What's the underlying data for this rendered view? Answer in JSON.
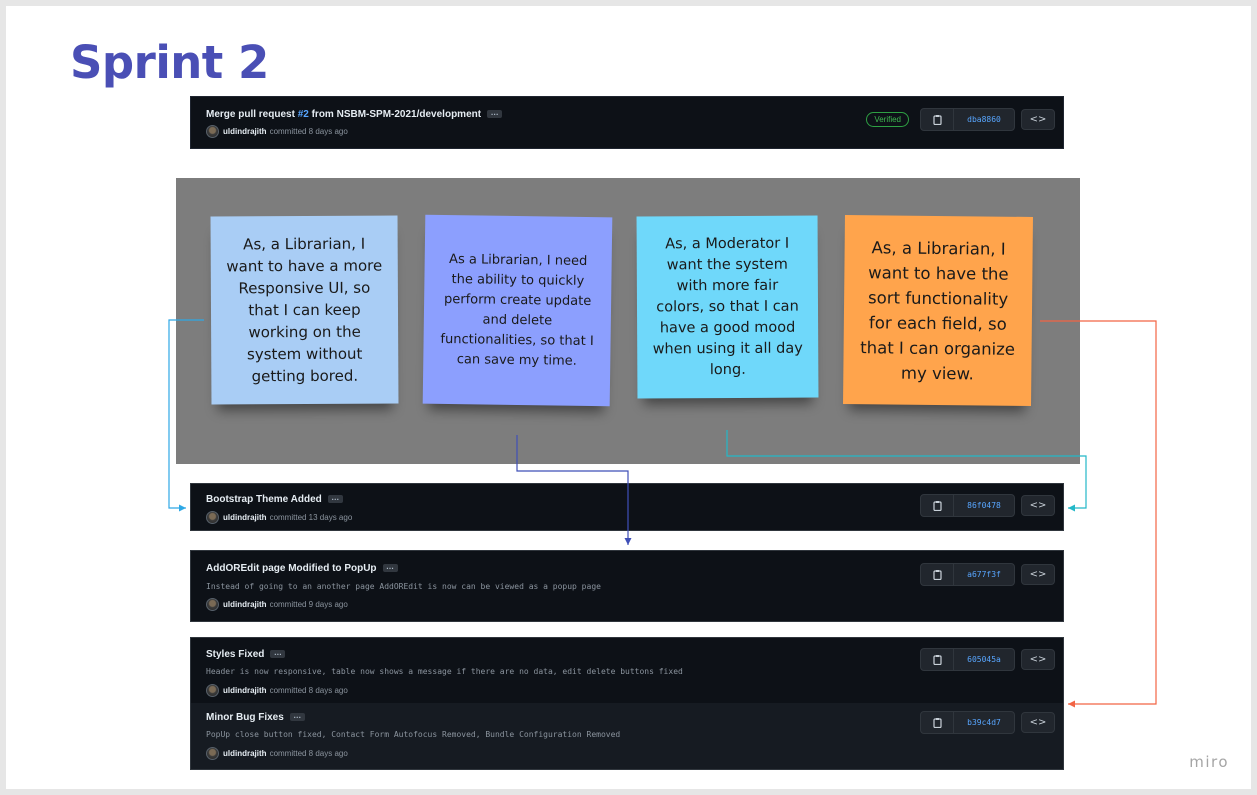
{
  "board": {
    "title": "Sprint 2",
    "watermark": "miro"
  },
  "top_commit": {
    "title_prefix": "Merge pull request ",
    "issue": "#2",
    "title_suffix": " from NSBM-SPM-2021/development",
    "author": "uldindrajith",
    "time": "committed 8 days ago",
    "badge": "Verified",
    "sha": "dba8860"
  },
  "stickies": [
    {
      "text": "As, a Librarian, I want to have a more Responsive UI, so that I can keep working on the system without getting bored.",
      "color": "#a9cdf5"
    },
    {
      "text": "As a Librarian, I need the ability to quickly perform create update and delete functionalities, so that I can save my time.",
      "color": "#8c9ffe"
    },
    {
      "text": "As, a Moderator I want the system with more fair colors, so that I can have a good mood when using it all day long.",
      "color": "#6fd8fa"
    },
    {
      "text": "As, a Librarian, I want to have the sort functionality for each field, so that I can organize my view.",
      "color": "#ffa44c"
    }
  ],
  "commits": [
    {
      "title": "Bootstrap Theme Added",
      "author": "uldindrajith",
      "time": "committed 13 days ago",
      "sha": "86f0478"
    },
    {
      "title": "AddOREdit page Modified to PopUp",
      "description": "Instead of going to an another page AddOREdit is now can be viewed as a popup page",
      "author": "uldindrajith",
      "time": "committed 9 days ago",
      "sha": "a677f3f"
    },
    {
      "title": "Styles Fixed",
      "description": "Header is now responsive, table now shows a message if there are no data, edit delete buttons fixed",
      "author": "uldindrajith",
      "time": "committed 8 days ago",
      "sha": "605045a"
    },
    {
      "title": "Minor Bug Fixes",
      "description": "PopUp close button fixed, Contact Form Autofocus Removed, Bundle Configuration Removed",
      "author": "uldindrajith",
      "time": "committed 8 days ago",
      "sha": "b39c4d7"
    }
  ],
  "icons": {
    "copy": "clipboard-icon",
    "browse": "code-icon",
    "more": "ellipsis-icon"
  },
  "colors": {
    "title": "#4a4fb5",
    "link_blue_connector": "#2ea8e5",
    "link_indigo_connector": "#3f4fb8",
    "link_teal_connector": "#23b8c8",
    "link_red_connector": "#f26444"
  }
}
